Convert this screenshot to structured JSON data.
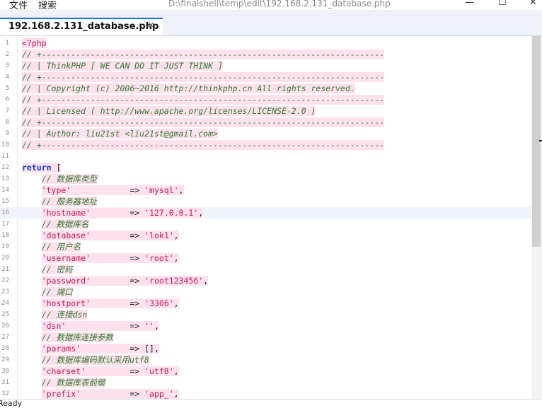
{
  "window": {
    "menu": [
      "文件",
      "搜索"
    ],
    "title": "D:\\finalshell\\temp\\edit\\192.168.2.131_database.php",
    "controls": {
      "minimize": "—",
      "maximize": "☐",
      "close": "✕"
    }
  },
  "tabs": [
    {
      "label": "192.168.2.131_database.php",
      "close": "✕"
    }
  ],
  "editor": {
    "current_line": 16,
    "lines": [
      {
        "n": "1",
        "t": [
          [
            "php",
            "<?php"
          ]
        ]
      },
      {
        "n": "2",
        "t": [
          [
            "comment",
            "// +----------------------------------------------------------------------"
          ]
        ]
      },
      {
        "n": "3",
        "t": [
          [
            "comment",
            "// | ThinkPHP [ WE CAN DO IT JUST THINK ]"
          ]
        ]
      },
      {
        "n": "4",
        "t": [
          [
            "comment",
            "// +----------------------------------------------------------------------"
          ]
        ]
      },
      {
        "n": "5",
        "t": [
          [
            "comment",
            "// | Copyright (c) 2006~2016 http://thinkphp.cn All rights reserved."
          ]
        ]
      },
      {
        "n": "6",
        "t": [
          [
            "comment",
            "// +----------------------------------------------------------------------"
          ]
        ]
      },
      {
        "n": "7",
        "t": [
          [
            "comment",
            "// | Licensed ( http://www.apache.org/licenses/LICENSE-2.0 )"
          ]
        ]
      },
      {
        "n": "8",
        "t": [
          [
            "comment",
            "// +----------------------------------------------------------------------"
          ]
        ]
      },
      {
        "n": "9",
        "t": [
          [
            "comment",
            "// | Author: liu21st <liu21st@gmail.com>"
          ]
        ]
      },
      {
        "n": "10",
        "t": [
          [
            "comment",
            "// +----------------------------------------------------------------------"
          ]
        ]
      },
      {
        "n": "11",
        "t": []
      },
      {
        "n": "12",
        "t": [
          [
            "kw",
            "return"
          ],
          [
            "op",
            " ["
          ]
        ]
      },
      {
        "n": "13",
        "t": [
          [
            "op",
            "    "
          ],
          [
            "comment",
            "// 数据库类型"
          ]
        ]
      },
      {
        "n": "14",
        "t": [
          [
            "op",
            "    "
          ],
          [
            "str",
            "'type'"
          ],
          [
            "op",
            "            => "
          ],
          [
            "str",
            "'mysql'"
          ],
          [
            "op",
            ","
          ]
        ]
      },
      {
        "n": "15",
        "t": [
          [
            "op",
            "    "
          ],
          [
            "comment",
            "// 服务器地址"
          ]
        ]
      },
      {
        "n": "16",
        "t": [
          [
            "op",
            "    "
          ],
          [
            "str",
            "'hostname'"
          ],
          [
            "op",
            "        => "
          ],
          [
            "str",
            "'127.0.0.1'"
          ],
          [
            "op",
            ","
          ]
        ]
      },
      {
        "n": "17",
        "t": [
          [
            "op",
            "    "
          ],
          [
            "comment",
            "// 数据库名"
          ]
        ]
      },
      {
        "n": "18",
        "t": [
          [
            "op",
            "    "
          ],
          [
            "str",
            "'database'"
          ],
          [
            "op",
            "        => "
          ],
          [
            "str",
            "'lok1'"
          ],
          [
            "op",
            ","
          ]
        ]
      },
      {
        "n": "19",
        "t": [
          [
            "op",
            "    "
          ],
          [
            "comment",
            "// 用户名"
          ]
        ]
      },
      {
        "n": "20",
        "t": [
          [
            "op",
            "    "
          ],
          [
            "str",
            "'username'"
          ],
          [
            "op",
            "        => "
          ],
          [
            "str",
            "'root'"
          ],
          [
            "op",
            ","
          ]
        ]
      },
      {
        "n": "21",
        "t": [
          [
            "op",
            "    "
          ],
          [
            "comment",
            "// 密码"
          ]
        ]
      },
      {
        "n": "22",
        "t": [
          [
            "op",
            "    "
          ],
          [
            "str",
            "'password'"
          ],
          [
            "op",
            "        => "
          ],
          [
            "str",
            "'root123456'"
          ],
          [
            "op",
            ","
          ]
        ]
      },
      {
        "n": "23",
        "t": [
          [
            "op",
            "    "
          ],
          [
            "comment",
            "// 端口"
          ]
        ]
      },
      {
        "n": "24",
        "t": [
          [
            "op",
            "    "
          ],
          [
            "str",
            "'hostport'"
          ],
          [
            "op",
            "        => "
          ],
          [
            "str",
            "'3306'"
          ],
          [
            "op",
            ","
          ]
        ]
      },
      {
        "n": "25",
        "t": [
          [
            "op",
            "    "
          ],
          [
            "comment",
            "// 连接dsn"
          ]
        ]
      },
      {
        "n": "26",
        "t": [
          [
            "op",
            "    "
          ],
          [
            "str",
            "'dsn'"
          ],
          [
            "op",
            "             => "
          ],
          [
            "str",
            "''"
          ],
          [
            "op",
            ","
          ]
        ]
      },
      {
        "n": "27",
        "t": [
          [
            "op",
            "    "
          ],
          [
            "comment",
            "// 数据库连接参数"
          ]
        ]
      },
      {
        "n": "28",
        "t": [
          [
            "op",
            "    "
          ],
          [
            "str",
            "'params'"
          ],
          [
            "op",
            "          => [],"
          ]
        ]
      },
      {
        "n": "29",
        "t": [
          [
            "op",
            "    "
          ],
          [
            "comment",
            "// 数据库编码默认采用utf8"
          ]
        ]
      },
      {
        "n": "30",
        "t": [
          [
            "op",
            "    "
          ],
          [
            "str",
            "'charset'"
          ],
          [
            "op",
            "         => "
          ],
          [
            "str",
            "'utf8'"
          ],
          [
            "op",
            ","
          ]
        ]
      },
      {
        "n": "31",
        "t": [
          [
            "op",
            "    "
          ],
          [
            "comment",
            "// 数据库表前缀"
          ]
        ]
      },
      {
        "n": "32",
        "t": [
          [
            "op",
            "    "
          ],
          [
            "str",
            "'prefix'"
          ],
          [
            "op",
            "          => "
          ],
          [
            "str",
            "'app_'"
          ],
          [
            "op",
            ","
          ]
        ]
      }
    ]
  },
  "status": {
    "text": "Ready"
  }
}
